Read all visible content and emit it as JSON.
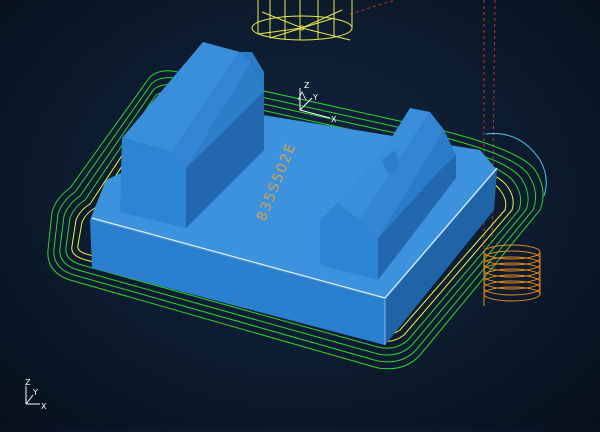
{
  "viewport": {
    "background": "#0c1b2e",
    "part_engraving": "835S502E",
    "colors": {
      "part_face": "#2f86d6",
      "part_top": "#3c92dd",
      "part_dark": "#2064a8",
      "toolpath_outer": "#2fd12f",
      "toolpath_inner": "#f2f238",
      "helix": "#e68a1c",
      "tool": "#e8e84a",
      "lead_in": "#4fc6e8",
      "engraving": "#d6a24a"
    }
  },
  "workplane_axis": {
    "z": "Z",
    "y": "Y",
    "x": "X"
  },
  "global_axis": {
    "z": "Z",
    "y": "Y",
    "x": "X"
  }
}
